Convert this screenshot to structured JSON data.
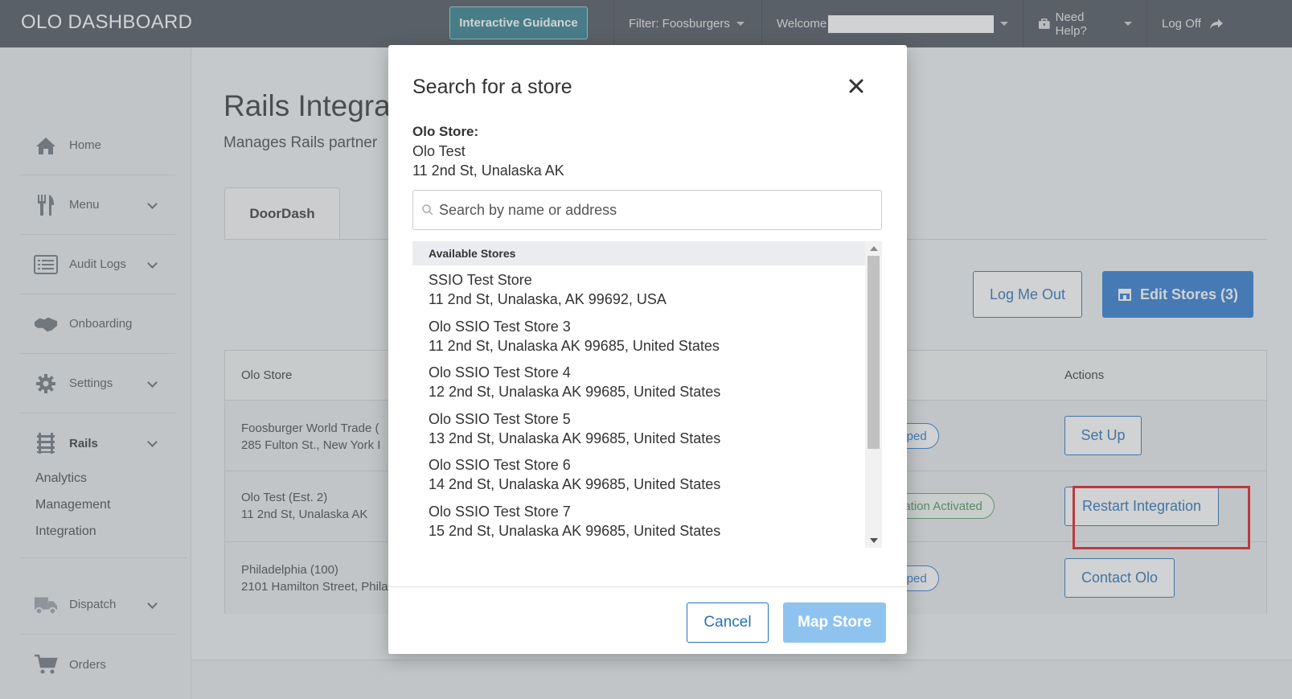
{
  "topbar": {
    "brand": "OLO DASHBOARD",
    "guidance_label": "Interactive Guidance",
    "filter_label": "Filter: Foosburgers",
    "welcome_label": "Welcome",
    "help_label": "Need Help?",
    "logoff_label": "Log Off"
  },
  "sidebar": {
    "items": [
      {
        "label": "Home",
        "icon": "home-icon"
      },
      {
        "label": "Menu",
        "icon": "utensils-icon"
      },
      {
        "label": "Audit Logs",
        "icon": "list-icon"
      },
      {
        "label": "Onboarding",
        "icon": "handshake-icon"
      },
      {
        "label": "Settings",
        "icon": "gear-icon"
      },
      {
        "label": "Rails",
        "icon": "rails-icon"
      },
      {
        "label": "Dispatch",
        "icon": "truck-icon"
      },
      {
        "label": "Orders",
        "icon": "cart-icon"
      }
    ],
    "rails_sub": [
      "Analytics",
      "Management",
      "Integration"
    ]
  },
  "main": {
    "title": "Rails Integra",
    "subtitle": "Manages Rails partner",
    "tab": "DoorDash",
    "log_me_out": "Log Me Out",
    "edit_stores": "Edit Stores (3)",
    "table": {
      "col_store": "Olo Store",
      "col_actions": "Actions",
      "rows": [
        {
          "name": "Foosburger World Trade (",
          "address": "285 Fulton St., New York I",
          "status": "apped",
          "action": "Set Up"
        },
        {
          "name": "Olo Test (Est. 2)",
          "address": "11 2nd St, Unalaska AK",
          "status": "gration Activated",
          "action": "Restart Integration"
        },
        {
          "name": "Philadelphia (100)",
          "address": "2101 Hamilton Street, Phila",
          "status": "apped",
          "action": "Contact Olo"
        }
      ]
    }
  },
  "modal": {
    "title": "Search for a store",
    "store_label": "Olo Store:",
    "store_name": "Olo Test",
    "store_address": "11 2nd St, Unalaska AK",
    "search_placeholder": "Search by name or address",
    "list_header": "Available Stores",
    "options": [
      {
        "name": "SSIO Test Store",
        "address": "11 2nd St, Unalaska, AK 99692, USA"
      },
      {
        "name": "Olo SSIO Test Store 3",
        "address": "11 2nd St, Unalaska AK 99685, United States"
      },
      {
        "name": "Olo SSIO Test Store 4",
        "address": "12 2nd St, Unalaska AK 99685, United States"
      },
      {
        "name": "Olo SSIO Test Store 5",
        "address": "13 2nd St, Unalaska AK 99685, United States"
      },
      {
        "name": "Olo SSIO Test Store 6",
        "address": "14 2nd St, Unalaska AK 99685, United States"
      },
      {
        "name": "Olo SSIO Test Store 7",
        "address": "15 2nd St, Unalaska AK 99685, United States"
      }
    ],
    "cancel_label": "Cancel",
    "map_label": "Map Store"
  },
  "colors": {
    "topbar": "#4a5159",
    "primary": "#2b78d0",
    "highlight": "#e0141b",
    "activated_green": "#5aa06a"
  }
}
